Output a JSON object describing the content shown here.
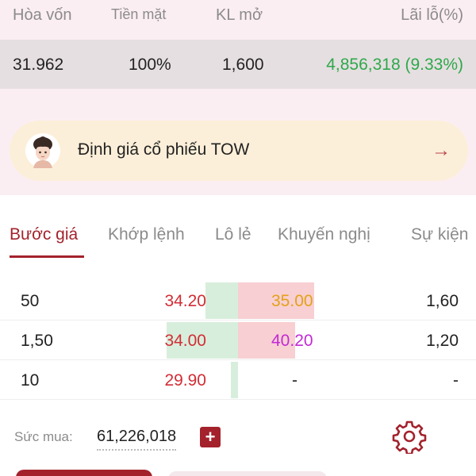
{
  "summary": {
    "headers": {
      "breakeven": "Hòa vốn",
      "cash": "Tiền mặt",
      "open_volume": "KL mở",
      "pnl": "Lãi lỗ(%)"
    },
    "values": {
      "breakeven": "31.962",
      "cash": "100%",
      "open_volume": "1,600",
      "pnl": "4,856,318 (9.33%)"
    }
  },
  "promo": {
    "text": "Định giá cổ phiếu TOW",
    "arrow": "→"
  },
  "tabs": [
    {
      "label": "Bước giá",
      "active": true
    },
    {
      "label": "Khớp lệnh",
      "active": false
    },
    {
      "label": "Lô lẻ",
      "active": false
    },
    {
      "label": "Khuyến nghị",
      "active": false
    },
    {
      "label": "Sự kiện",
      "active": false
    }
  ],
  "order_book": {
    "rows": [
      {
        "bid_volume": "50",
        "bid_price": "34.20",
        "ask_price": "35.00",
        "ask_price_color": "#e3a21a",
        "ask_volume": "1,60",
        "bid_bar": 0.45,
        "ask_bar": 1.0
      },
      {
        "bid_volume": "1,50",
        "bid_price": "34.00",
        "ask_price": "40.20",
        "ask_price_color": "#c22ad6",
        "ask_volume": "1,20",
        "bid_bar": 1.0,
        "ask_bar": 0.75
      },
      {
        "bid_volume": "10",
        "bid_price": "29.90",
        "ask_price": "-",
        "ask_price_color": "#222222",
        "ask_volume": "-",
        "bid_bar": 0.1,
        "ask_bar": 0
      }
    ]
  },
  "footer": {
    "buying_power_label": "Sức mua:",
    "buying_power_value": "61,226,018",
    "add_label": "+"
  },
  "colors": {
    "accent": "#a3222c",
    "positive": "#2ea94b",
    "negative": "#d22d35"
  },
  "icons": [
    "avatar-icon",
    "arrow-right-icon",
    "plus-icon",
    "gear-icon"
  ]
}
